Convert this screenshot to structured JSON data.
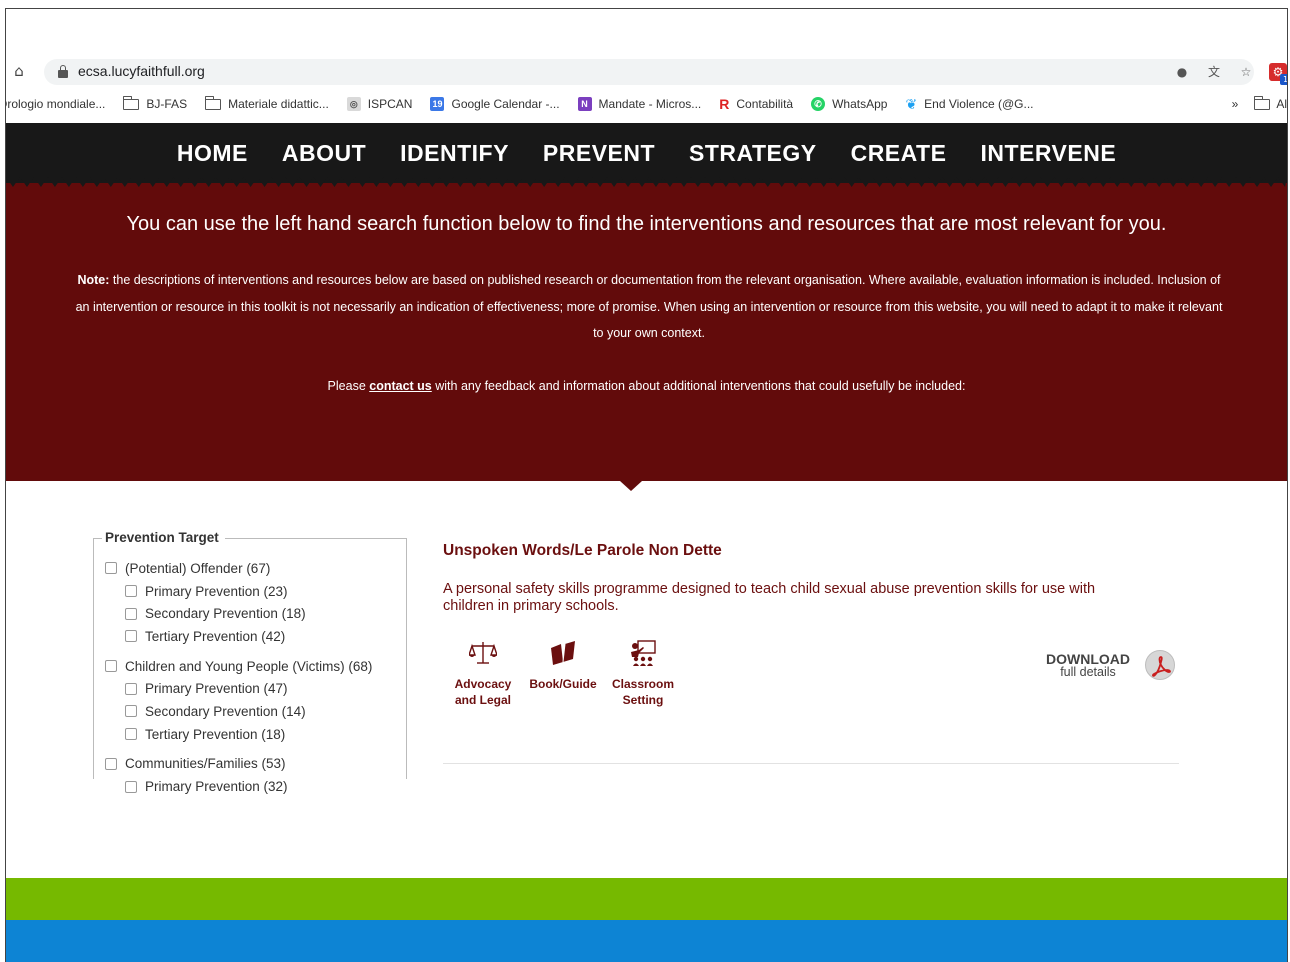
{
  "browser": {
    "url": "ecsa.lucyfaithfull.org",
    "bookmarks": [
      {
        "label": "Orologio mondiale...",
        "icon": "none"
      },
      {
        "label": "BJ-FAS",
        "icon": "folder-icon"
      },
      {
        "label": "Materiale didattic...",
        "icon": "folder-icon"
      },
      {
        "label": "ISPCAN",
        "icon": "ispcan-icon"
      },
      {
        "label": "Google Calendar -...",
        "icon": "calendar-icon"
      },
      {
        "label": "Mandate - Micros...",
        "icon": "onenote-icon"
      },
      {
        "label": "Contabilità",
        "icon": "r-icon"
      },
      {
        "label": "WhatsApp",
        "icon": "whatsapp-icon"
      },
      {
        "label": "End Violence (@G...",
        "icon": "twitter-icon"
      }
    ],
    "bookmarks_overflow": "»",
    "bookmarks_other": "Al",
    "ext_badge": "1",
    "calendar_day": "19"
  },
  "nav": {
    "items": [
      "HOME",
      "ABOUT",
      "IDENTIFY",
      "PREVENT",
      "STRATEGY",
      "CREATE",
      "INTERVENE"
    ]
  },
  "hero": {
    "title": "You can use the left hand search function below to find the interventions and resources that are most relevant for you.",
    "note_label": "Note:",
    "note_text": " the descriptions of interventions and resources below are based on published research or documentation from the relevant organisation. Where available, evaluation information is included. Inclusion of an intervention or resource in this toolkit is not necessarily an indication of effectiveness; more of promise. When using an intervention or resource from this website, you will need to adapt it to make it relevant to your own context.",
    "contact_prefix": "Please ",
    "contact_link": "contact us",
    "contact_suffix": " with any feedback and information about additional interventions that could usefully be included:"
  },
  "filter": {
    "legend": "Prevention Target",
    "items": [
      {
        "label": "(Potential) Offender (67)",
        "level": 0
      },
      {
        "label": "Primary Prevention (23)",
        "level": 1
      },
      {
        "label": "Secondary Prevention (18)",
        "level": 1
      },
      {
        "label": "Tertiary Prevention (42)",
        "level": 1
      },
      {
        "label": "Children and Young People (Victims) (68)",
        "level": 0
      },
      {
        "label": "Primary Prevention (47)",
        "level": 1
      },
      {
        "label": "Secondary Prevention (14)",
        "level": 1
      },
      {
        "label": "Tertiary Prevention (18)",
        "level": 1
      },
      {
        "label": "Communities/Families (53)",
        "level": 0
      },
      {
        "label": "Primary Prevention (32)",
        "level": 1
      }
    ]
  },
  "result": {
    "title": "Unspoken Words/Le Parole Non Dette",
    "description": "A personal safety skills programme designed to teach child sexual abuse prevention skills for use with children in primary schools.",
    "tags": [
      {
        "label": "Advocacy and Legal",
        "icon": "scales-icon"
      },
      {
        "label": "Book/Guide",
        "icon": "book-icon"
      },
      {
        "label": "Classroom Setting",
        "icon": "classroom-icon"
      }
    ],
    "download_label": "DOWNLOAD",
    "download_sub": "full details"
  },
  "colors": {
    "nav_bg": "#181818",
    "hero_bg": "#620b0b",
    "accent_text": "#6b0f0f",
    "green_band": "#76b900",
    "blue_band": "#0d84d4"
  }
}
